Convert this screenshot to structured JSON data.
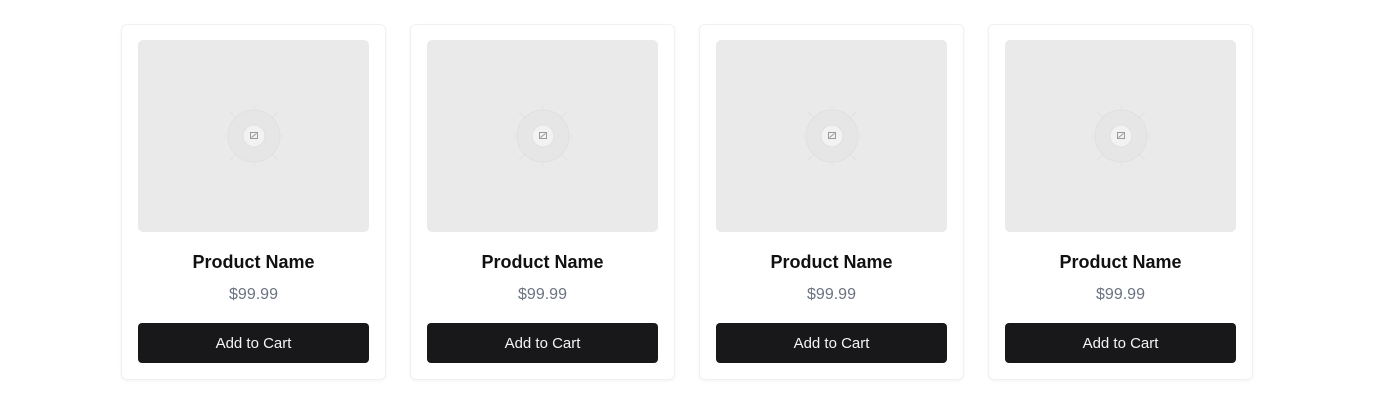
{
  "products": [
    {
      "name": "Product Name",
      "price": "$99.99",
      "button_label": "Add to Cart",
      "image_icon": "image-placeholder-icon"
    },
    {
      "name": "Product Name",
      "price": "$99.99",
      "button_label": "Add to Cart",
      "image_icon": "image-placeholder-icon"
    },
    {
      "name": "Product Name",
      "price": "$99.99",
      "button_label": "Add to Cart",
      "image_icon": "image-placeholder-icon"
    },
    {
      "name": "Product Name",
      "price": "$99.99",
      "button_label": "Add to Cart",
      "image_icon": "image-placeholder-icon"
    }
  ],
  "colors": {
    "placeholder_bg": "#eaeaea",
    "button_bg": "#18181b",
    "button_text": "#f4f4f5",
    "price_text": "#6b7280"
  }
}
